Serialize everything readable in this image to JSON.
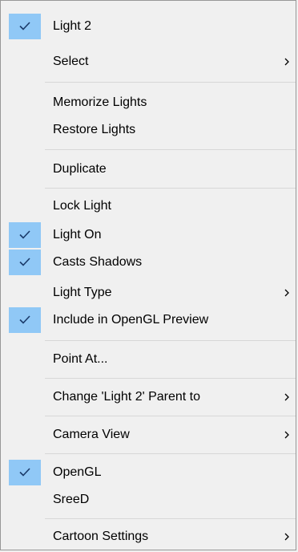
{
  "menu": {
    "items": [
      {
        "label": "Light 2",
        "checked": true,
        "submenu": false
      },
      {
        "label": "Select",
        "checked": false,
        "submenu": true
      },
      {
        "label": "Memorize Lights",
        "checked": false,
        "submenu": false
      },
      {
        "label": "Restore Lights",
        "checked": false,
        "submenu": false
      },
      {
        "label": "Duplicate",
        "checked": false,
        "submenu": false
      },
      {
        "label": "Lock Light",
        "checked": false,
        "submenu": false
      },
      {
        "label": "Light On",
        "checked": true,
        "submenu": false
      },
      {
        "label": "Casts Shadows",
        "checked": true,
        "submenu": false
      },
      {
        "label": "Light Type",
        "checked": false,
        "submenu": true
      },
      {
        "label": "Include in OpenGL Preview",
        "checked": true,
        "submenu": false
      },
      {
        "label": "Point At...",
        "checked": false,
        "submenu": false
      },
      {
        "label": "Change 'Light 2' Parent to",
        "checked": false,
        "submenu": true
      },
      {
        "label": "Camera View",
        "checked": false,
        "submenu": true
      },
      {
        "label": "OpenGL",
        "checked": true,
        "submenu": false
      },
      {
        "label": "SreeD",
        "checked": false,
        "submenu": false
      },
      {
        "label": "Cartoon Settings",
        "checked": false,
        "submenu": true
      }
    ]
  },
  "colors": {
    "menu_background": "#f0f0f0",
    "check_highlight": "#90c8f6",
    "separator": "#d7d7d7",
    "border": "#979797"
  },
  "icons": {
    "check": "checkmark-icon",
    "submenu": "chevron-right-icon"
  }
}
